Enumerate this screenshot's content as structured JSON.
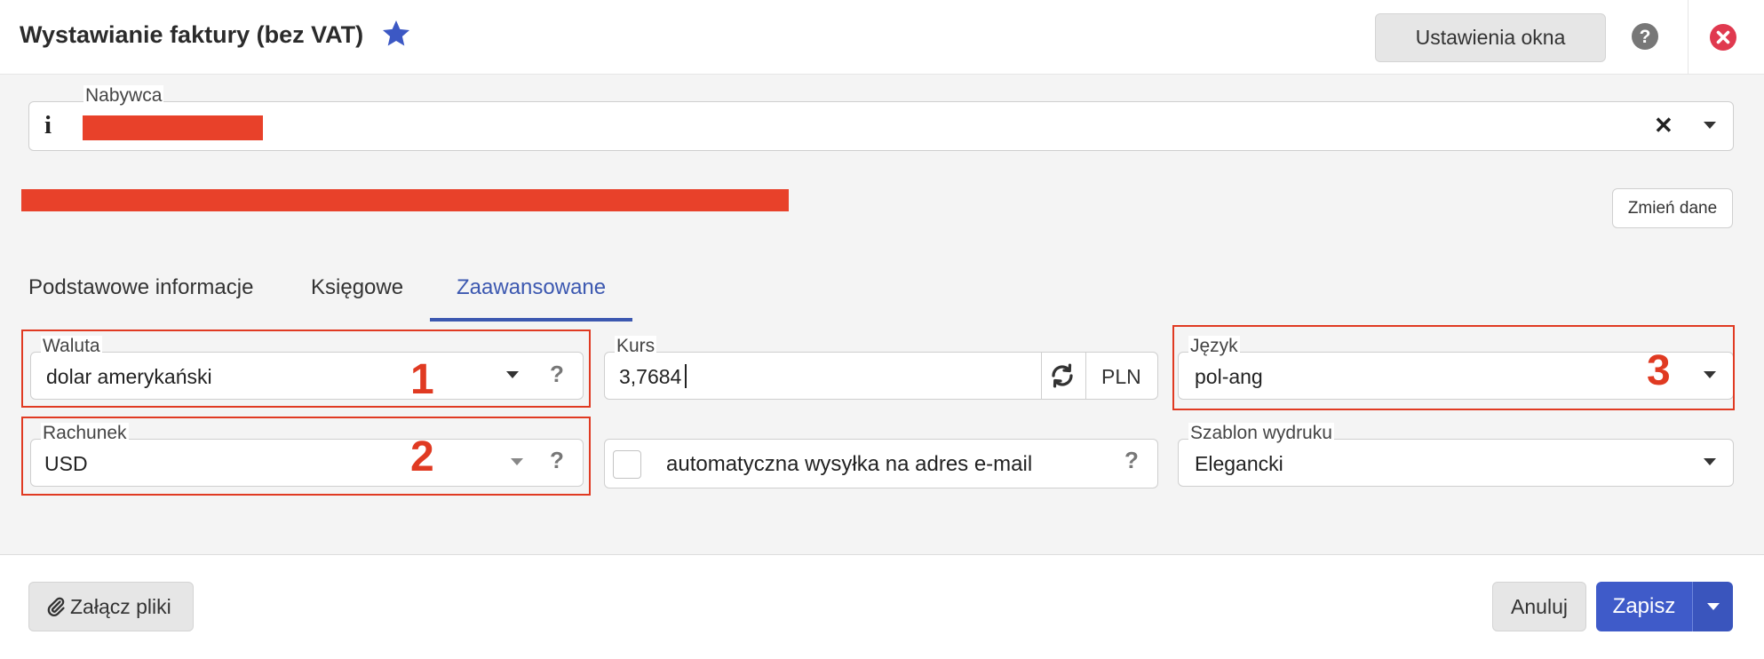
{
  "header": {
    "title": "Wystawianie faktury (bez VAT)",
    "settings_button": "Ustawienia okna",
    "colors": {
      "star": "#3c58c4",
      "close": "#e0394f",
      "help": "#777777"
    }
  },
  "buyer": {
    "label": "Nabywca",
    "info_icon": "i",
    "clear_icon": "✕",
    "change_button": "Zmień dane"
  },
  "tabs": [
    {
      "label": "Podstawowe informacje",
      "active": false
    },
    {
      "label": "Księgowe",
      "active": false
    },
    {
      "label": "Zaawansowane",
      "active": true
    }
  ],
  "fields": {
    "currency": {
      "label": "Waluta",
      "value": "dolar amerykański",
      "annotation": "1"
    },
    "rate": {
      "label": "Kurs",
      "value": "3,7684",
      "unit": "PLN"
    },
    "language": {
      "label": "Język",
      "value": "pol-ang",
      "annotation": "3"
    },
    "account": {
      "label": "Rachunek",
      "value": "USD",
      "annotation": "2"
    },
    "auto_email": {
      "label": "automatyczna wysyłka na adres e-mail",
      "checked": false
    },
    "template": {
      "label": "Szablon wydruku",
      "value": "Elegancki"
    }
  },
  "footer": {
    "attach_button": "Załącz pliki",
    "cancel_button": "Anuluj",
    "save_button": "Zapisz"
  },
  "accent_color": "#3f5bc9",
  "annotation_color": "#e03a22"
}
